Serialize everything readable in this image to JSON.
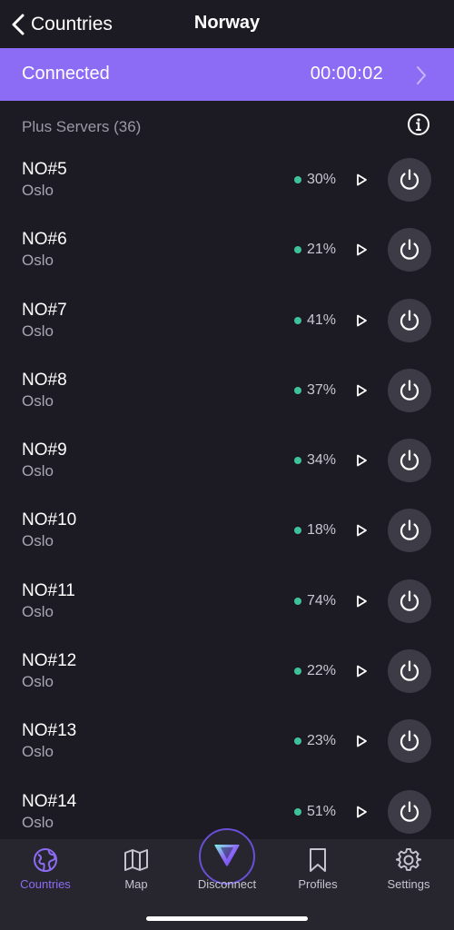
{
  "nav": {
    "back_label": "Countries",
    "title": "Norway"
  },
  "banner": {
    "status": "Connected",
    "timer": "00:00:02",
    "color": "#8d6cf5"
  },
  "section": {
    "title": "Plus Servers (36)"
  },
  "servers": [
    {
      "name": "NO#5",
      "city": "Oslo",
      "load": "30%"
    },
    {
      "name": "NO#6",
      "city": "Oslo",
      "load": "21%"
    },
    {
      "name": "NO#7",
      "city": "Oslo",
      "load": "41%"
    },
    {
      "name": "NO#8",
      "city": "Oslo",
      "load": "37%"
    },
    {
      "name": "NO#9",
      "city": "Oslo",
      "load": "34%"
    },
    {
      "name": "NO#10",
      "city": "Oslo",
      "load": "18%"
    },
    {
      "name": "NO#11",
      "city": "Oslo",
      "load": "74%"
    },
    {
      "name": "NO#12",
      "city": "Oslo",
      "load": "22%"
    },
    {
      "name": "NO#13",
      "city": "Oslo",
      "load": "23%"
    },
    {
      "name": "NO#14",
      "city": "Oslo",
      "load": "51%"
    }
  ],
  "tabs": [
    {
      "label": "Countries",
      "icon": "globe-icon",
      "active": true
    },
    {
      "label": "Map",
      "icon": "map-icon",
      "active": false
    },
    {
      "label": "Disconnect",
      "icon": "proton-logo-icon",
      "active": false
    },
    {
      "label": "Profiles",
      "icon": "bookmark-icon",
      "active": false
    },
    {
      "label": "Settings",
      "icon": "gear-icon",
      "active": false
    }
  ],
  "colors": {
    "background": "#1c1b23",
    "accent": "#8d6cf5",
    "load_ok": "#3ec29a"
  }
}
